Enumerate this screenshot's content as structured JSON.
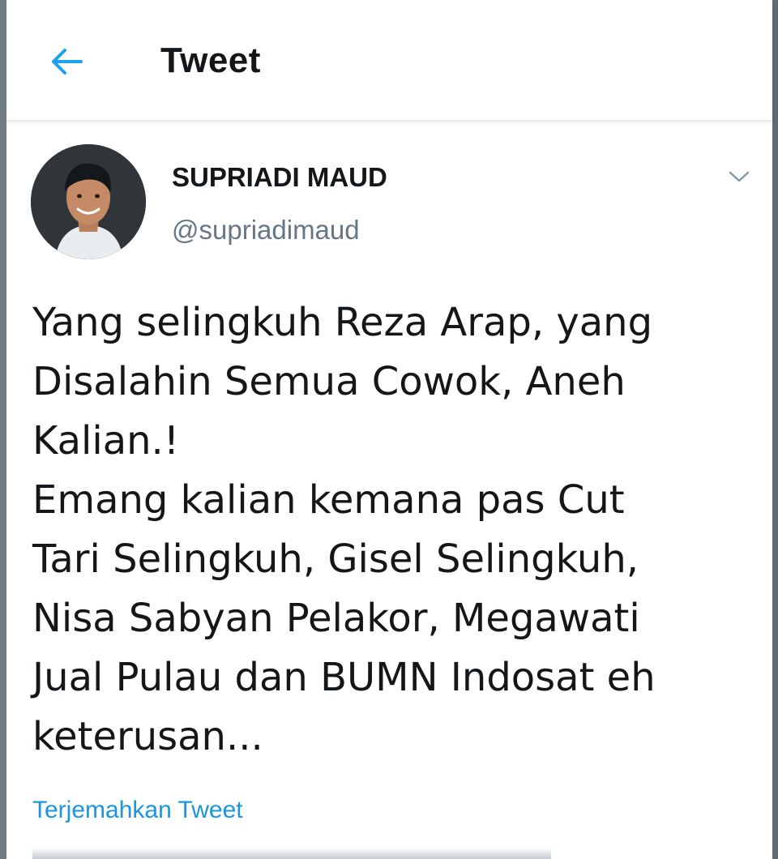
{
  "header": {
    "title": "Tweet",
    "back_icon": "arrow-left-icon",
    "accent_color": "#1da1f2"
  },
  "tweet": {
    "author_name": "SUPRIADI MAUD",
    "author_handle": "@supriadimaud",
    "menu_icon": "chevron-down-icon",
    "text": "Yang selingkuh Reza Arap, yang\nDisalahin Semua Cowok, Aneh\nKalian.!\nEmang kalian kemana pas Cut\nTari Selingkuh, Gisel Selingkuh,\nNisa Sabyan Pelakor, Megawati\nJual Pulau dan BUMN Indosat eh\nketerusan...",
    "translate_label": "Terjemahkan Tweet",
    "link_color": "#1b95e0"
  }
}
